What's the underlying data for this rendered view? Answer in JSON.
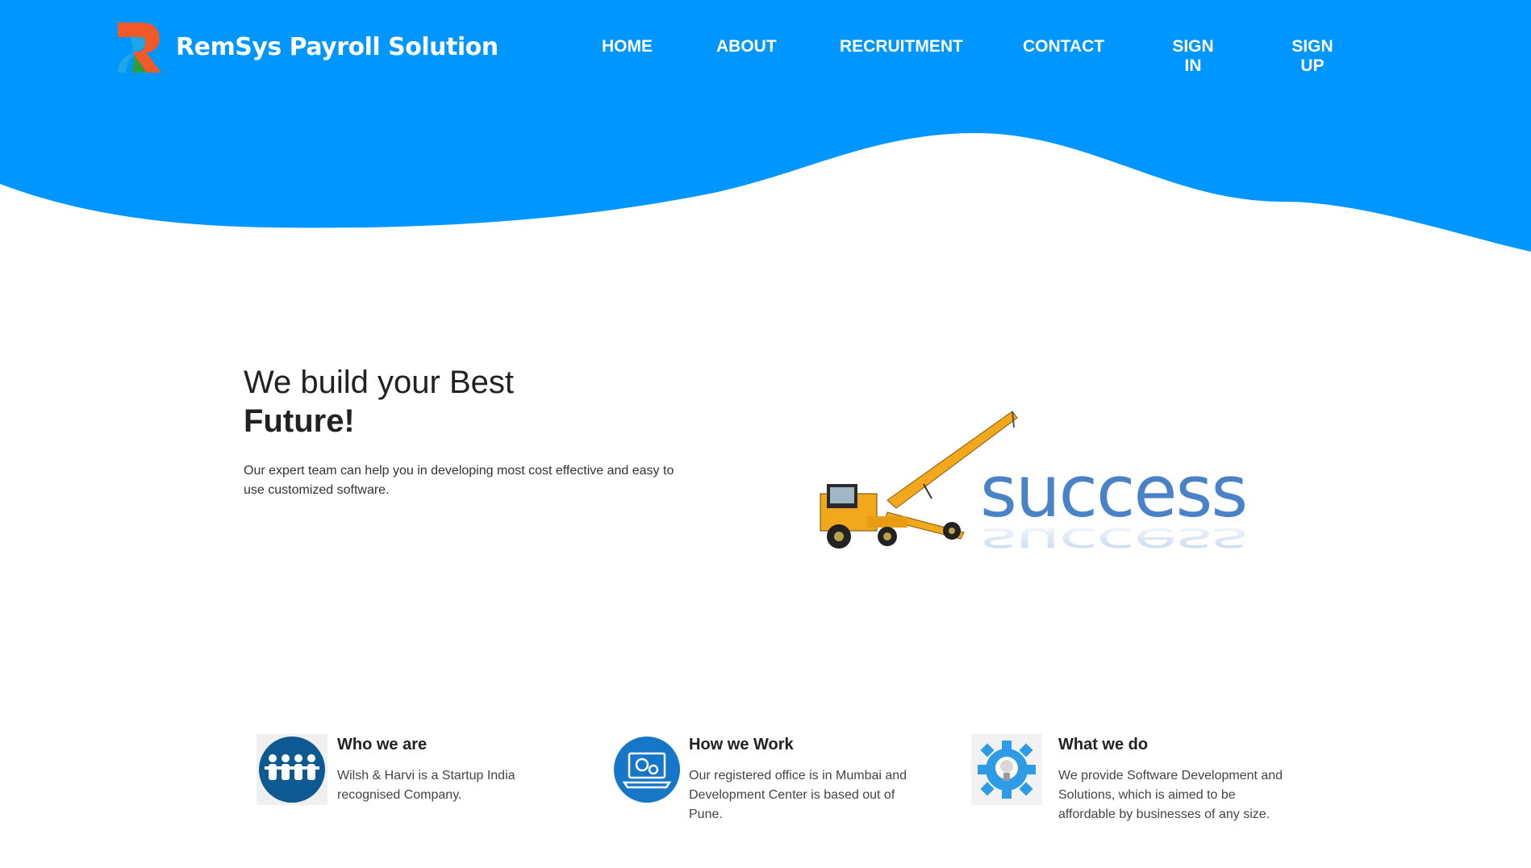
{
  "brand": {
    "name": "RemSys Payroll Solution",
    "primary_color": "#0096FF",
    "logo_colors": [
      "#F05A28",
      "#1E88E5",
      "#2E9E44"
    ]
  },
  "nav": {
    "items": [
      {
        "label": "HOME"
      },
      {
        "label": "ABOUT"
      },
      {
        "label": "RECRUITMENT"
      },
      {
        "label": "CONTACT"
      },
      {
        "label": "SIGN IN"
      },
      {
        "label": "SIGN UP"
      }
    ]
  },
  "hero": {
    "title_line1": "We build your Best",
    "title_line2": "Future!",
    "subtitle": "Our expert team can help you in developing most cost effective and easy to use customized software.",
    "image_text": "success",
    "image_icon": "crane-vehicle-icon"
  },
  "features": [
    {
      "title": "Who we are",
      "text": "Wilsh & Harvi is a Startup India recognised Company.",
      "icon": "team-people-icon"
    },
    {
      "title": "How we Work",
      "text": "Our registered office is in Mumbai and Development Center is based out of Pune.",
      "icon": "laptop-gears-icon"
    },
    {
      "title": "What we do",
      "text": "We provide Software Development and Solutions, which is aimed to be affordable by businesses of any size.",
      "icon": "gear-bulb-icon"
    }
  ]
}
